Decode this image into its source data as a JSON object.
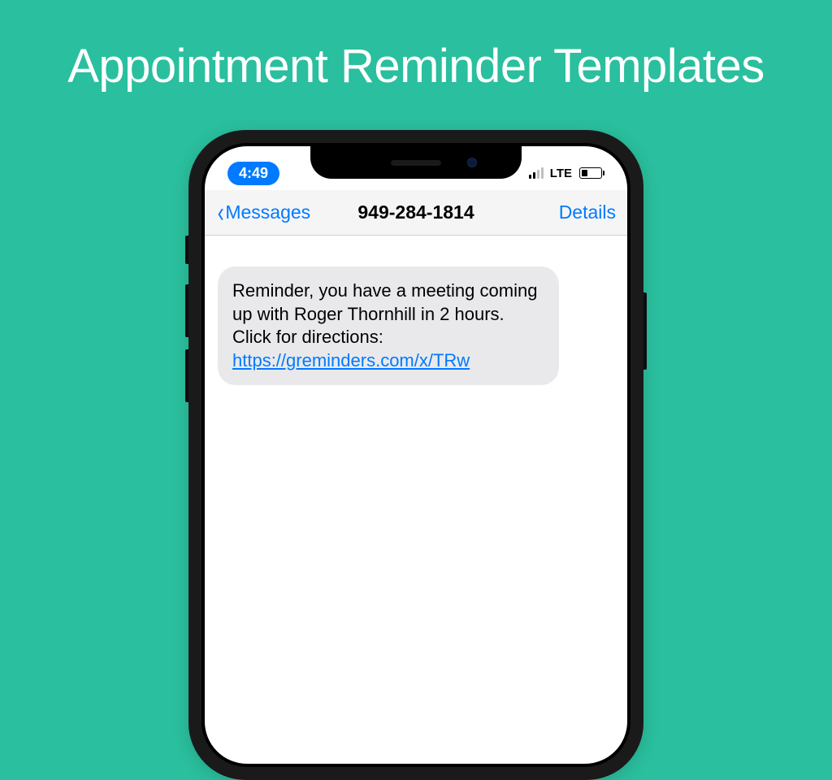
{
  "page": {
    "title": "Appointment Reminder Templates"
  },
  "phone": {
    "status": {
      "time": "4:49",
      "network": "LTE"
    },
    "nav": {
      "back_label": "Messages",
      "title": "949-284-1814",
      "details_label": "Details"
    },
    "message": {
      "text": "Reminder, you have a meeting coming up with Roger Thornhill in 2 hours. Click for directions: ",
      "link": "https://greminders.com/x/TRw"
    }
  }
}
